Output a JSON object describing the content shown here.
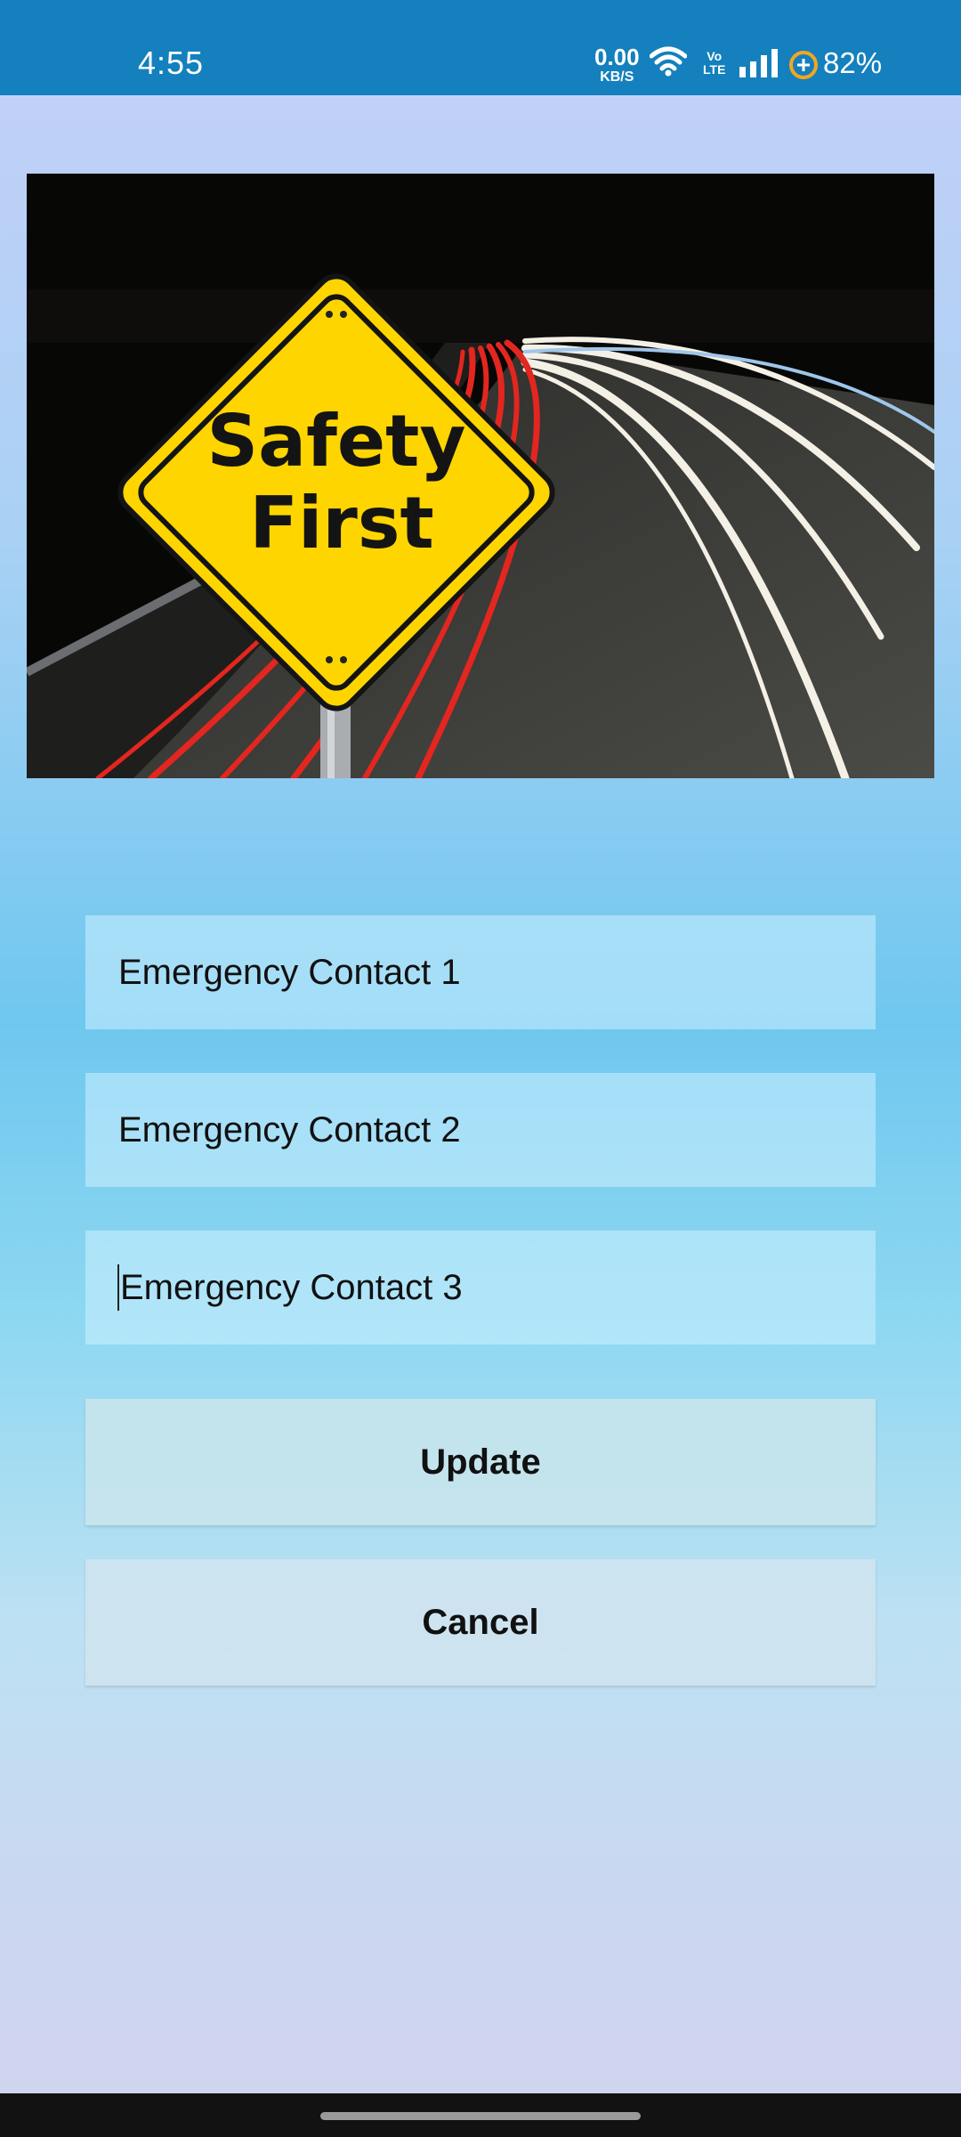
{
  "status_bar": {
    "time": "4:55",
    "net_speed_value": "0.00",
    "net_speed_unit": "KB/S",
    "volte_top": "Vo",
    "volte_bottom": "LTE",
    "battery": "82%"
  },
  "hero_image": {
    "sign_line_1": "Safety",
    "sign_line_2": "First"
  },
  "form": {
    "contact1_placeholder": "Emergency Contact 1",
    "contact2_placeholder": "Emergency Contact 2",
    "contact3_placeholder": "Emergency Contact 3"
  },
  "buttons": {
    "update": "Update",
    "cancel": "Cancel"
  },
  "colors": {
    "status_bar": "#1480bd",
    "sign_yellow": "#ffd500"
  }
}
